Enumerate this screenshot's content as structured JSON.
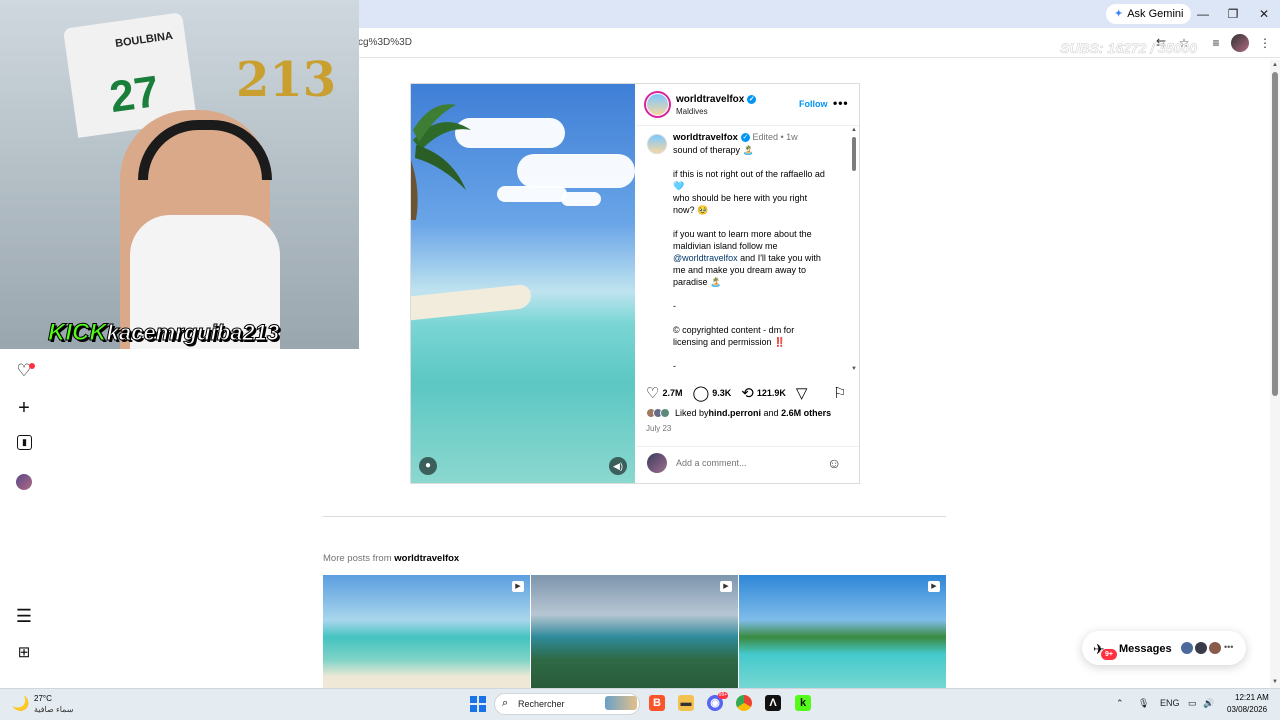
{
  "browser": {
    "ask_gemini": "Ask Gemini",
    "url_fragment": "cg%3D%3D",
    "watermark": "SUBS: 16272 / 35000"
  },
  "webcam": {
    "jersey_name": "BOULBINA",
    "jersey_number": "27",
    "balloon_text": "213",
    "kick_logo": "KICK",
    "kick_user": "kacemrguiba213"
  },
  "post": {
    "username": "worldtravelfox",
    "location": "Maldives",
    "follow_label": "Follow",
    "caption_meta": "Edited • 1w",
    "caption_lines": [
      "sound of therapy 🏝️",
      "",
      "if this is not right out of the raffaello ad",
      "🩵",
      "who should be here with you right",
      "now? 🥹",
      "",
      "if you want to learn more about the",
      "maldivian island follow me",
      "",
      "me and make you dream away to",
      "paradise 🏝️",
      "",
      "-",
      "",
      "© copyrighted content - dm for",
      "licensing and permission ‼️",
      "",
      "-"
    ],
    "caption_mention": "@worldtravelfox",
    "caption_mention_rest": " and I'll take you with",
    "likes": "2.7M",
    "comments": "9.3K",
    "reposts": "121.9K",
    "liked_by_prefix": "Liked by ",
    "liked_by_user": "hind.perroni",
    "liked_by_suffix_and": " and ",
    "liked_by_others": "2.6M others",
    "date": "July 23",
    "comment_placeholder": "Add a comment..."
  },
  "more_posts": {
    "prefix": "More posts from ",
    "user": "worldtravelfox"
  },
  "messages": {
    "label": "Messages",
    "badge": "9+"
  },
  "taskbar": {
    "temperature": "27°C",
    "weather_desc": "سماء صافية",
    "search_placeholder": "Rechercher",
    "language": "ENG",
    "time": "12:21 AM",
    "date": "03/08/2026"
  },
  "colors": {
    "instagram_blue": "#0095f6",
    "kick_green": "#53fc18",
    "notification_red": "#ff3040"
  }
}
